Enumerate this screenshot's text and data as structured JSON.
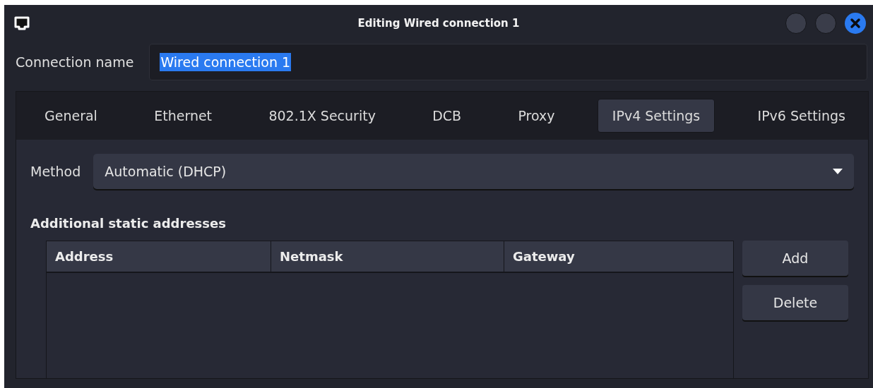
{
  "window": {
    "title": "Editing Wired connection 1"
  },
  "connection_name": {
    "label": "Connection name",
    "value": "Wired connection 1",
    "value_selected": true
  },
  "tabs": [
    {
      "label": "General",
      "selected": false
    },
    {
      "label": "Ethernet",
      "selected": false
    },
    {
      "label": "802.1X Security",
      "selected": false
    },
    {
      "label": "DCB",
      "selected": false
    },
    {
      "label": "Proxy",
      "selected": false
    },
    {
      "label": "IPv4 Settings",
      "selected": true
    },
    {
      "label": "IPv6 Settings",
      "selected": false
    }
  ],
  "method": {
    "label": "Method",
    "value": "Automatic (DHCP)"
  },
  "addresses": {
    "heading": "Additional static addresses",
    "columns": [
      "Address",
      "Netmask",
      "Gateway"
    ],
    "buttons": [
      "Add",
      "Delete"
    ]
  }
}
